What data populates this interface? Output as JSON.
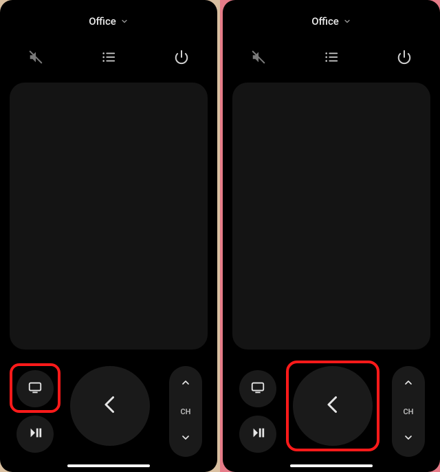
{
  "left": {
    "room_name": "Office",
    "channel_label": "CH"
  },
  "right": {
    "room_name": "Office",
    "channel_label": "CH"
  }
}
